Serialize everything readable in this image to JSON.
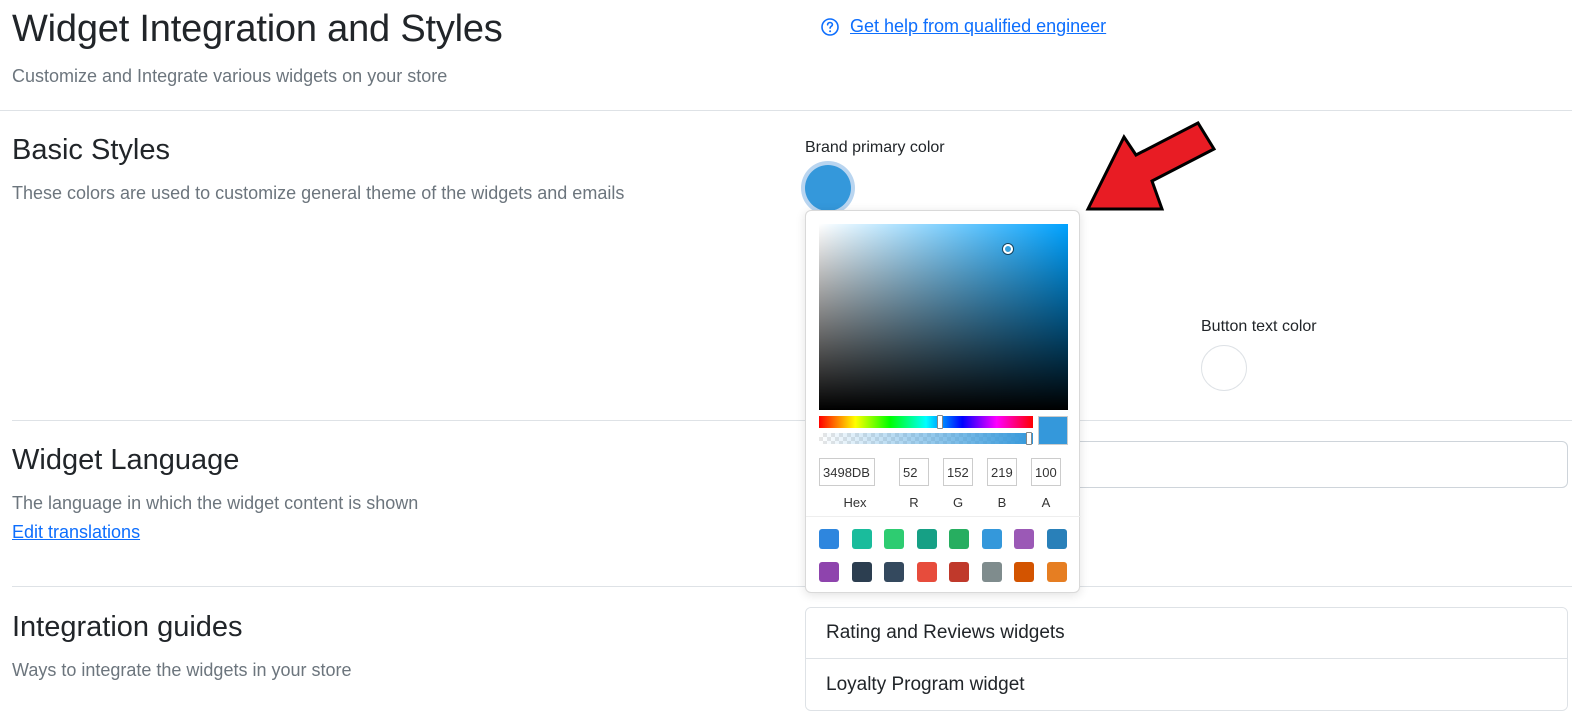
{
  "header": {
    "title": "Widget Integration and Styles",
    "subtitle": "Customize and Integrate various widgets on your store",
    "help_link": "Get help from qualified engineer"
  },
  "basic_styles": {
    "title": "Basic Styles",
    "description": "These colors are used to customize general theme of the widgets and emails",
    "brand_primary_label": "Brand primary color",
    "brand_primary_value": "#3498db",
    "button_text_label": "Button text color",
    "button_text_value": "#ffffff"
  },
  "color_picker": {
    "hex": "3498DB",
    "r": "52",
    "g": "152",
    "b": "219",
    "a": "100",
    "labels": {
      "hex": "Hex",
      "r": "R",
      "g": "G",
      "b": "B",
      "a": "A"
    },
    "presets": [
      "#2e86de",
      "#1abc9c",
      "#2ecc71",
      "#16a085",
      "#27ae60",
      "#3498db",
      "#9b59b6",
      "#2980b9",
      "#8e44ad",
      "#2c3e50",
      "#34495e",
      "#e74c3c",
      "#c0392b",
      "#7f8c8d",
      "#d35400",
      "#e67e22"
    ]
  },
  "widget_language": {
    "title": "Widget Language",
    "description": "The language in which the widget content is shown",
    "edit_link": "Edit translations"
  },
  "integration_guides": {
    "title": "Integration guides",
    "description": "Ways to integrate the widgets in your store",
    "items": [
      "Rating and Reviews widgets",
      "Loyalty Program widget"
    ]
  }
}
